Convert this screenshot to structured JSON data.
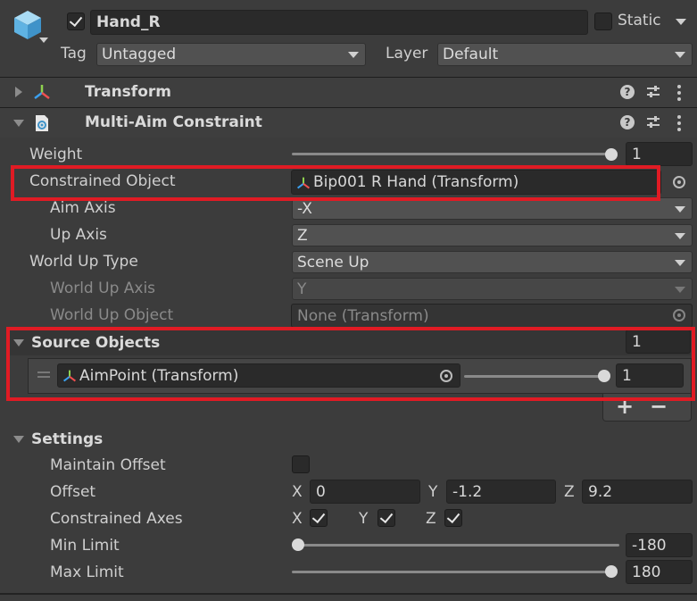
{
  "header": {
    "object_name": "Hand_R",
    "active_checked": true,
    "static_label": "Static",
    "tag_label": "Tag",
    "tag_value": "Untagged",
    "layer_label": "Layer",
    "layer_value": "Default"
  },
  "components": {
    "transform": {
      "title": "Transform"
    },
    "constraint": {
      "title": "Multi-Aim Constraint"
    }
  },
  "props": {
    "weight": {
      "label": "Weight",
      "value": "1",
      "slider_fraction": 1.0
    },
    "constrained_object": {
      "label": "Constrained Object",
      "value": "Bip001 R Hand (Transform)"
    },
    "aim_axis": {
      "label": "Aim Axis",
      "value": "-X"
    },
    "up_axis": {
      "label": "Up Axis",
      "value": "Z"
    },
    "world_up_type": {
      "label": "World Up Type",
      "value": "Scene Up"
    },
    "world_up_axis": {
      "label": "World Up Axis",
      "value": "Y"
    },
    "world_up_object": {
      "label": "World Up Object",
      "value": "None (Transform)"
    }
  },
  "source_objects": {
    "title": "Source Objects",
    "count": "1",
    "items": [
      {
        "name": "AimPoint (Transform)",
        "weight": "1",
        "slider_fraction": 1.0
      }
    ],
    "add_label": "+",
    "remove_label": "−"
  },
  "settings": {
    "title": "Settings",
    "maintain_offset": {
      "label": "Maintain Offset",
      "checked": false
    },
    "offset": {
      "label": "Offset",
      "x_label": "X",
      "x": "0",
      "y_label": "Y",
      "y": "-1.2",
      "z_label": "Z",
      "z": "9.2"
    },
    "constrained_axes": {
      "label": "Constrained Axes",
      "x_label": "X",
      "y_label": "Y",
      "z_label": "Z"
    },
    "min_limit": {
      "label": "Min Limit",
      "value": "-180",
      "slider_fraction": 0.0
    },
    "max_limit": {
      "label": "Max Limit",
      "value": "180",
      "slider_fraction": 1.0
    }
  }
}
